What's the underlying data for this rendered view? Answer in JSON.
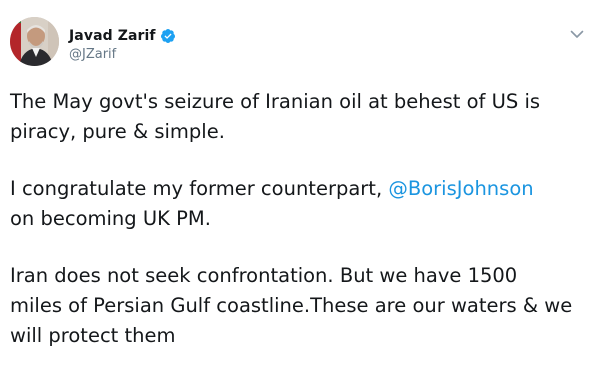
{
  "author": {
    "display_name": "Javad Zarif",
    "handle": "@JZarif",
    "verified": true
  },
  "icons": {
    "verified": "verified-badge-icon",
    "menu": "chevron-down-icon"
  },
  "colors": {
    "text": "#14171a",
    "handle": "#657786",
    "link": "#1b95e0",
    "verified": "#1da1f2"
  },
  "tweet": {
    "paragraphs": [
      {
        "lines": [
          "The May govt's seizure of Iranian oil at behest of US is",
          "piracy, pure & simple."
        ]
      },
      {
        "line1_text": "I congratulate my former counterpart, ",
        "mention": "@BorisJohnson",
        "line2_text": "on becoming UK PM."
      },
      {
        "lines": [
          "Iran does not seek confrontation. But we have 1500",
          "miles of Persian Gulf coastline.These are our waters & we",
          "will protect them"
        ]
      }
    ]
  }
}
